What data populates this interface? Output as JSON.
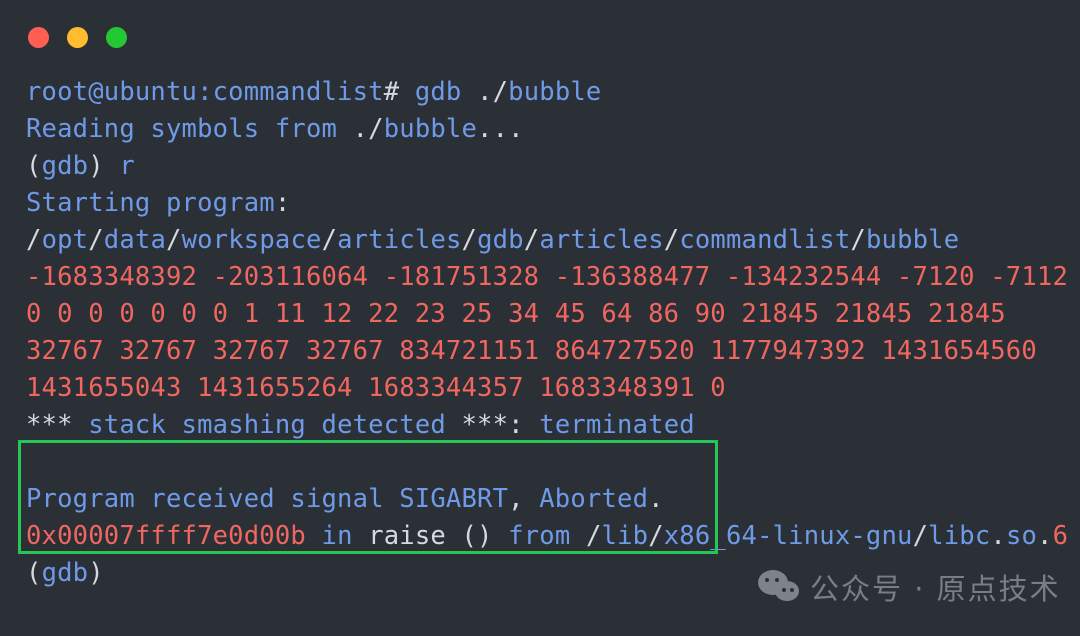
{
  "window": {
    "title": "terminal",
    "controls": [
      {
        "name": "close",
        "color": "#ff5f52"
      },
      {
        "name": "minimize",
        "color": "#ffbc2e"
      },
      {
        "name": "maximize",
        "color": "#23c832"
      }
    ]
  },
  "theme": {
    "background": "#2b3037",
    "foreground": "#d5dae1",
    "blue": "#6f9ae8",
    "red": "#f1675f",
    "highlight_border": "#25c653"
  },
  "terminal": {
    "lines": [
      {
        "id": "line-prompt-gdb",
        "text": "root@ubuntu:commandlist# gdb ./bubble",
        "tokens": [
          {
            "t": "root@ubuntu:commandlist",
            "c": "blue"
          },
          {
            "t": "#",
            "c": "white"
          },
          {
            "t": " ",
            "c": "white"
          },
          {
            "t": "gdb",
            "c": "blue"
          },
          {
            "t": " ",
            "c": "white"
          },
          {
            "t": "./",
            "c": "white"
          },
          {
            "t": "bubble",
            "c": "blue"
          }
        ]
      },
      {
        "id": "line-reading-symbols",
        "text": "Reading symbols from ./bubble...",
        "tokens": [
          {
            "t": "Reading symbols from ",
            "c": "blue"
          },
          {
            "t": "./",
            "c": "white"
          },
          {
            "t": "bubble",
            "c": "blue"
          },
          {
            "t": "...",
            "c": "white"
          }
        ]
      },
      {
        "id": "line-gdb-r",
        "text": "(gdb) r",
        "tokens": [
          {
            "t": "(",
            "c": "white"
          },
          {
            "t": "gdb",
            "c": "blue"
          },
          {
            "t": ")",
            "c": "white"
          },
          {
            "t": " ",
            "c": "white"
          },
          {
            "t": "r",
            "c": "blue"
          }
        ]
      },
      {
        "id": "line-starting-program",
        "text": "Starting program:",
        "tokens": [
          {
            "t": "Starting program",
            "c": "blue"
          },
          {
            "t": ":",
            "c": "white"
          }
        ]
      },
      {
        "id": "line-program-path",
        "text": "/opt/data/workspace/articles/gdb/articles/commandlist/bubble",
        "tokens": [
          {
            "t": "/",
            "c": "white"
          },
          {
            "t": "opt",
            "c": "blue"
          },
          {
            "t": "/",
            "c": "white"
          },
          {
            "t": "data",
            "c": "blue"
          },
          {
            "t": "/",
            "c": "white"
          },
          {
            "t": "workspace",
            "c": "blue"
          },
          {
            "t": "/",
            "c": "white"
          },
          {
            "t": "articles",
            "c": "blue"
          },
          {
            "t": "/",
            "c": "white"
          },
          {
            "t": "gdb",
            "c": "blue"
          },
          {
            "t": "/",
            "c": "white"
          },
          {
            "t": "articles",
            "c": "blue"
          },
          {
            "t": "/",
            "c": "white"
          },
          {
            "t": "commandlist",
            "c": "blue"
          },
          {
            "t": "/",
            "c": "white"
          },
          {
            "t": "bubble",
            "c": "blue"
          }
        ]
      },
      {
        "id": "line-values-1",
        "text": "-1683348392 -203116064 -181751328 -136388477 -134232544 -7120 -7112",
        "tokens": [
          {
            "t": "-1683348392 -203116064 -181751328 -136388477 -134232544 -7120 -7112",
            "c": "red"
          }
        ]
      },
      {
        "id": "line-values-2",
        "text": "0 0 0 0 0 0 0 1 11 12 22 23 25 34 45 64 86 90 21845 21845 21845",
        "tokens": [
          {
            "t": "0 0 0 0 0 0 0 1 11 12 22 23 25 34 45 64 86 90 21845 21845 21845",
            "c": "red"
          }
        ]
      },
      {
        "id": "line-values-3",
        "text": "32767 32767 32767 32767 834721151 864727520 1177947392 1431654560",
        "tokens": [
          {
            "t": "32767 32767 32767 32767 834721151 864727520 1177947392 1431654560",
            "c": "red"
          }
        ]
      },
      {
        "id": "line-values-4",
        "text": "1431655043 1431655264 1683344357 1683348391 0",
        "tokens": [
          {
            "t": "1431655043 1431655264 1683344357 1683348391 0",
            "c": "red"
          }
        ]
      }
    ],
    "highlighted_lines": [
      {
        "id": "line-stack-smashing",
        "text": "*** stack smashing detected ***: terminated",
        "tokens": [
          {
            "t": "***",
            "c": "white"
          },
          {
            "t": " ",
            "c": "white"
          },
          {
            "t": "stack smashing detected",
            "c": "blue"
          },
          {
            "t": " ",
            "c": "white"
          },
          {
            "t": "***",
            "c": "white"
          },
          {
            "t": ":",
            "c": "white"
          },
          {
            "t": " ",
            "c": "white"
          },
          {
            "t": "terminated",
            "c": "blue"
          }
        ]
      },
      {
        "id": "line-blank",
        "text": " ",
        "tokens": [
          {
            "t": " ",
            "c": "white"
          }
        ]
      },
      {
        "id": "line-sigabrt",
        "text": "Program received signal SIGABRT, Aborted.",
        "tokens": [
          {
            "t": "Program received signal SIGABRT",
            "c": "blue"
          },
          {
            "t": ",",
            "c": "white"
          },
          {
            "t": " ",
            "c": "white"
          },
          {
            "t": "Aborted",
            "c": "blue"
          },
          {
            "t": ".",
            "c": "white"
          }
        ]
      }
    ],
    "trailing_lines": [
      {
        "id": "line-frame-raise",
        "text": "0x00007ffff7e0d00b in raise () from /lib/x86_64-linux-gnu/libc.so.6",
        "tokens": [
          {
            "t": "0x00007ffff7e0d00b",
            "c": "red"
          },
          {
            "t": " ",
            "c": "white"
          },
          {
            "t": "in",
            "c": "blue"
          },
          {
            "t": " ",
            "c": "white"
          },
          {
            "t": "raise ()",
            "c": "white"
          },
          {
            "t": " ",
            "c": "white"
          },
          {
            "t": "from",
            "c": "blue"
          },
          {
            "t": " ",
            "c": "white"
          },
          {
            "t": "/",
            "c": "white"
          },
          {
            "t": "lib",
            "c": "blue"
          },
          {
            "t": "/",
            "c": "white"
          },
          {
            "t": "x86_64-linux-gnu",
            "c": "blue"
          },
          {
            "t": "/",
            "c": "white"
          },
          {
            "t": "libc",
            "c": "blue"
          },
          {
            "t": ".",
            "c": "white"
          },
          {
            "t": "so",
            "c": "blue"
          },
          {
            "t": ".",
            "c": "white"
          },
          {
            "t": "6",
            "c": "red"
          }
        ]
      },
      {
        "id": "line-gdb-prompt-final",
        "text": "(gdb)",
        "tokens": [
          {
            "t": "(",
            "c": "white"
          },
          {
            "t": "gdb",
            "c": "blue"
          },
          {
            "t": ")",
            "c": "white"
          }
        ]
      }
    ]
  },
  "watermark": {
    "text": "公众号 · 原点技术",
    "icon": "wechat-icon"
  }
}
